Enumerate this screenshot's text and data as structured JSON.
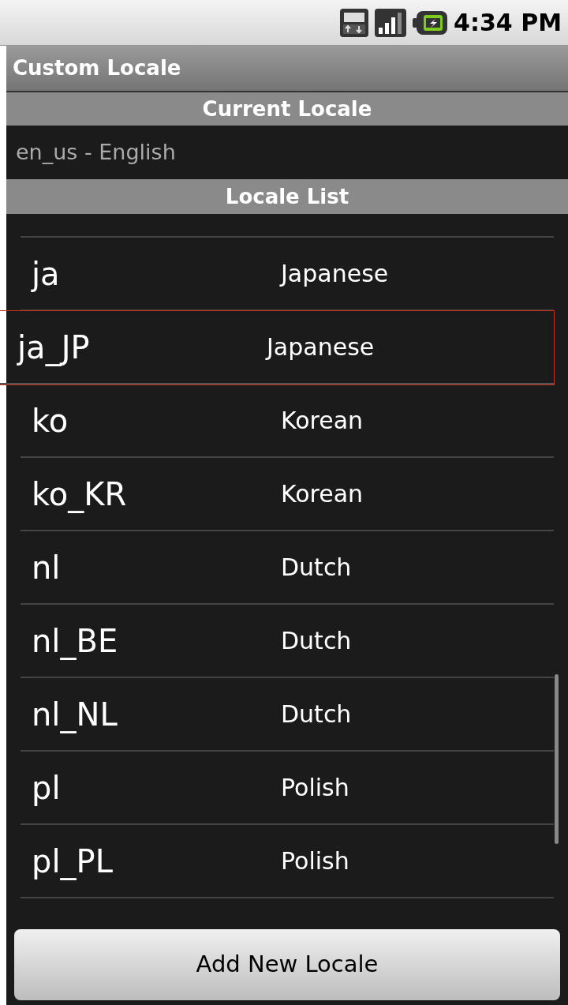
{
  "status_bar": {
    "time": "4:34 PM"
  },
  "title": "Custom Locale",
  "current_locale": {
    "header": "Current Locale",
    "value": "en_us - English"
  },
  "locale_list": {
    "header": "Locale List",
    "items": [
      {
        "code": "ja",
        "name": "Japanese",
        "selected": false
      },
      {
        "code": "ja_JP",
        "name": "Japanese",
        "selected": true
      },
      {
        "code": "ko",
        "name": "Korean",
        "selected": false
      },
      {
        "code": "ko_KR",
        "name": "Korean",
        "selected": false
      },
      {
        "code": "nl",
        "name": "Dutch",
        "selected": false
      },
      {
        "code": "nl_BE",
        "name": "Dutch",
        "selected": false
      },
      {
        "code": "nl_NL",
        "name": "Dutch",
        "selected": false
      },
      {
        "code": "pl",
        "name": "Polish",
        "selected": false
      },
      {
        "code": "pl_PL",
        "name": "Polish",
        "selected": false
      }
    ]
  },
  "add_button": "Add New Locale"
}
